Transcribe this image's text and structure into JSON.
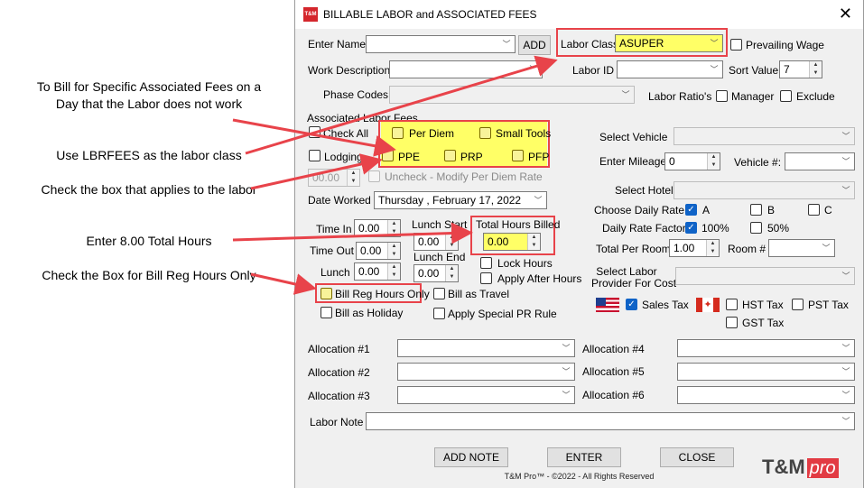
{
  "annotations": {
    "specific_fees": "To Bill for Specific Associated Fees on a Day that the Labor does not work",
    "use_lbrfees": "Use LBRFEES as the labor class",
    "check_box": "Check the box that applies to the labor",
    "enter_hours": "Enter 8.00 Total Hours",
    "bill_reg": "Check the Box for Bill Reg Hours Only"
  },
  "window": {
    "title": "BILLABLE LABOR and ASSOCIATED FEES",
    "logo_text": "T&M",
    "close_glyph": "✕"
  },
  "form": {
    "enter_name_label": "Enter Name",
    "enter_name_value": "",
    "add_button": "ADD",
    "labor_class_label": "Labor Class",
    "labor_class_value": "ASUPER",
    "prevailing_wage_label": "Prevailing Wage",
    "work_description_label": "Work Description",
    "labor_id_label": "Labor ID",
    "sort_value_label": "Sort Value",
    "sort_value": "7",
    "phase_codes_label": "Phase Codes",
    "labor_ratios_label": "Labor Ratio's",
    "manager_label": "Manager",
    "exclude_label": "Exclude",
    "assoc_fees_label": "Associated Labor Fees",
    "check_all_label": "Check All",
    "per_diem_label": "Per Diem",
    "small_tools_label": "Small Tools",
    "lodging_label": "Lodging",
    "ppe_label": "PPE",
    "prp_label": "PRP",
    "pfp_label": "PFP",
    "per_diem_amount": "00.00",
    "uncheck_label": "Uncheck - Modify Per Diem Rate",
    "date_worked_label": "Date Worked",
    "date_worked_value": "Thursday  ,  February  17, 2022",
    "time_in_label": "Time In",
    "time_in_value": "0.00",
    "time_out_label": "Time Out",
    "time_out_value": "0.00",
    "lunch_label": "Lunch",
    "lunch_value": "0.00",
    "lunch_start_label": "Lunch Start",
    "lunch_start_value": "0.00",
    "lunch_end_label": "Lunch End",
    "lunch_end_value": "0.00",
    "total_hours_label": "Total Hours Billed",
    "total_hours_value": "0.00",
    "lock_hours_label": "Lock Hours",
    "apply_after_hours_label": "Apply After Hours",
    "bill_reg_hours_label": "Bill Reg Hours Only",
    "bill_as_travel_label": "Bill as Travel",
    "bill_as_holiday_label": "Bill as Holiday",
    "apply_special_pr_label": "Apply Special PR Rule",
    "select_vehicle_label": "Select Vehicle",
    "enter_mileage_label": "Enter Mileage",
    "enter_mileage_value": "0",
    "vehicle_num_label": "Vehicle #:",
    "select_hotel_label": "Select Hotel",
    "choose_daily_rate_label": "Choose Daily Rate",
    "rate_a": "A",
    "rate_b": "B",
    "rate_c": "C",
    "daily_rate_factor_label": "Daily Rate Factor",
    "factor_100": "100%",
    "factor_50": "50%",
    "total_per_room_label": "Total Per Room",
    "total_per_room_value": "1.00",
    "room_num_label": "Room #",
    "labor_provider_label_1": "Select Labor",
    "labor_provider_label_2": "Provider For Cost",
    "sales_tax_label": "Sales Tax",
    "hst_tax_label": "HST Tax",
    "pst_tax_label": "PST Tax",
    "gst_tax_label": "GST Tax",
    "allocation_1": "Allocation #1",
    "allocation_2": "Allocation #2",
    "allocation_3": "Allocation #3",
    "allocation_4": "Allocation #4",
    "allocation_5": "Allocation #5",
    "allocation_6": "Allocation #6",
    "labor_note_label": "Labor Note"
  },
  "buttons": {
    "add_note": "ADD NOTE",
    "enter": "ENTER",
    "close": "CLOSE"
  },
  "footer": "T&M Pro™ - ©2022 - All Rights Reserved",
  "brand": {
    "main": "T&M",
    "pro": "pro"
  },
  "colors": {
    "highlight": "#e8434a",
    "yellow": "#ffff66",
    "check_blue": "#0f63c7"
  }
}
